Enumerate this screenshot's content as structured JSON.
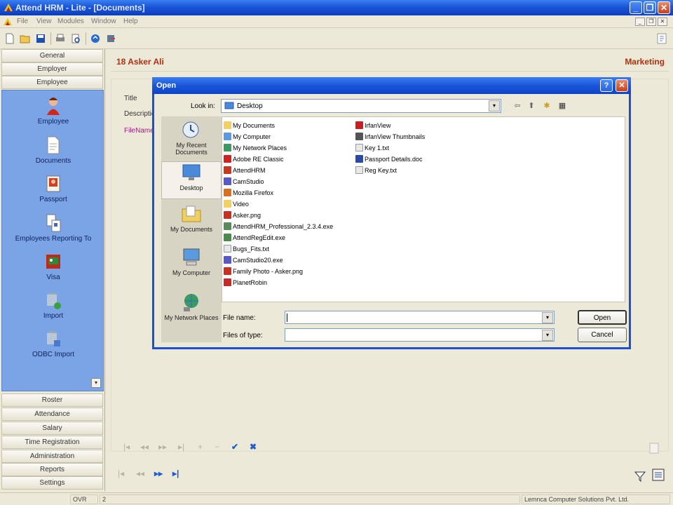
{
  "titlebar": {
    "title": "Attend HRM - Lite - [Documents]",
    "min": "_",
    "restore": "❐",
    "close": "✕"
  },
  "menubar": {
    "items": [
      "File",
      "View",
      "Modules",
      "Window",
      "Help"
    ],
    "mdi_min": "_",
    "mdi_restore": "❐",
    "mdi_close": "✕"
  },
  "leftnav": {
    "top_buttons": [
      "General",
      "Employer",
      "Employee"
    ],
    "items": [
      "Employee",
      "Documents",
      "Passport",
      "Employees Reporting To",
      "Visa",
      "Import",
      "ODBC Import"
    ],
    "scroll": "▾",
    "bottom_buttons": [
      "Roster",
      "Attendance",
      "Salary",
      "Time Registration",
      "Administration",
      "Reports",
      "Settings"
    ]
  },
  "record": {
    "id_name": "18  Asker Ali",
    "department": "Marketing",
    "fields": [
      "Title",
      "Descriptio",
      "FileName"
    ]
  },
  "record_nav": {
    "first": "|◂",
    "prev": "◂◂",
    "next": "▸▸",
    "last": "▸|",
    "add": "+",
    "remove": "−",
    "save": "✔",
    "cancel": "✖"
  },
  "bottom_nav": {
    "first": "|◂",
    "prev": "◂◂",
    "next": "▸▸",
    "last": "▸|"
  },
  "statusbar": {
    "cells": [
      "OVR",
      "2",
      "Lemnca Computer Solutions Pvt. Ltd."
    ]
  },
  "dialog": {
    "title": "Open",
    "help": "?",
    "close": "✕",
    "look_in_label": "Look in:",
    "look_in_value": "Desktop",
    "tools": [
      "⇦",
      "⬆",
      "✱",
      "▦"
    ],
    "places": [
      "My Recent Documents",
      "Desktop",
      "My Documents",
      "My Computer",
      "My Network Places"
    ],
    "files_col1": [
      "My Documents",
      "My Computer",
      "My Network Places",
      "Adobe RE Classic",
      "AttendHRM",
      "CamStudio",
      "Mozilla Firefox",
      "Video",
      "Asker.png",
      "AttendHRM_Professional_2.3.4.exe",
      "AttendRegEdit.exe",
      "Bugs_Fits.txt",
      "CamStudio20.exe",
      "Family Photo - Asker.png",
      "PlanetRobin"
    ],
    "files_col2": [
      "IrfanView",
      "IrfanView Thumbnails",
      "Key 1.txt",
      "Passport Details.doc",
      "Reg Key.txt"
    ],
    "file_name_label": "File name:",
    "file_name_value": "",
    "files_of_type_label": "Files of type:",
    "files_of_type_value": "",
    "open_button": "Open",
    "cancel_button": "Cancel",
    "arrow": "▾"
  },
  "colors": {
    "titlebar": "#1a55d8",
    "nav_panel": "#7aa4e6",
    "record_title": "#b03010",
    "dialog_border": "#1c4fd8"
  }
}
